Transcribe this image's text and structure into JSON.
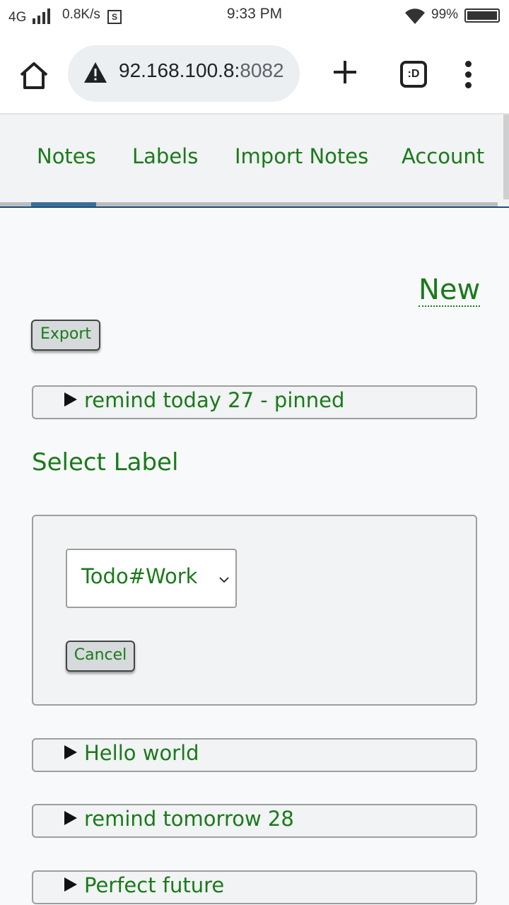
{
  "status_bar": {
    "network": "4G",
    "speed": "0.8K/s",
    "sync_icon_label": "S",
    "time": "9:33 PM",
    "battery": "99%"
  },
  "browser": {
    "url_host": "92.168.100.8:",
    "url_port": "8082",
    "tab_switcher_label": ":D",
    "icons": [
      "home-icon",
      "warning-icon",
      "plus-icon",
      "tab-switcher-icon",
      "more-menu-icon"
    ]
  },
  "nav": {
    "items": [
      {
        "label": "Notes"
      },
      {
        "label": "Labels"
      },
      {
        "label": "Import Notes"
      },
      {
        "label": "Account"
      }
    ]
  },
  "main": {
    "new_label": "New",
    "export_label": "Export",
    "pinned_note": "remind today 27 - pinned",
    "select_label_heading": "Select Label",
    "label_select_value": "Todo#Work",
    "cancel_label": "Cancel",
    "notes": [
      {
        "title": "Hello world"
      },
      {
        "title": "remind tomorrow 28"
      },
      {
        "title": "Perfect future"
      }
    ]
  },
  "colors": {
    "link_green": "#1a7a1a",
    "nav_accent": "#3d6f96"
  }
}
